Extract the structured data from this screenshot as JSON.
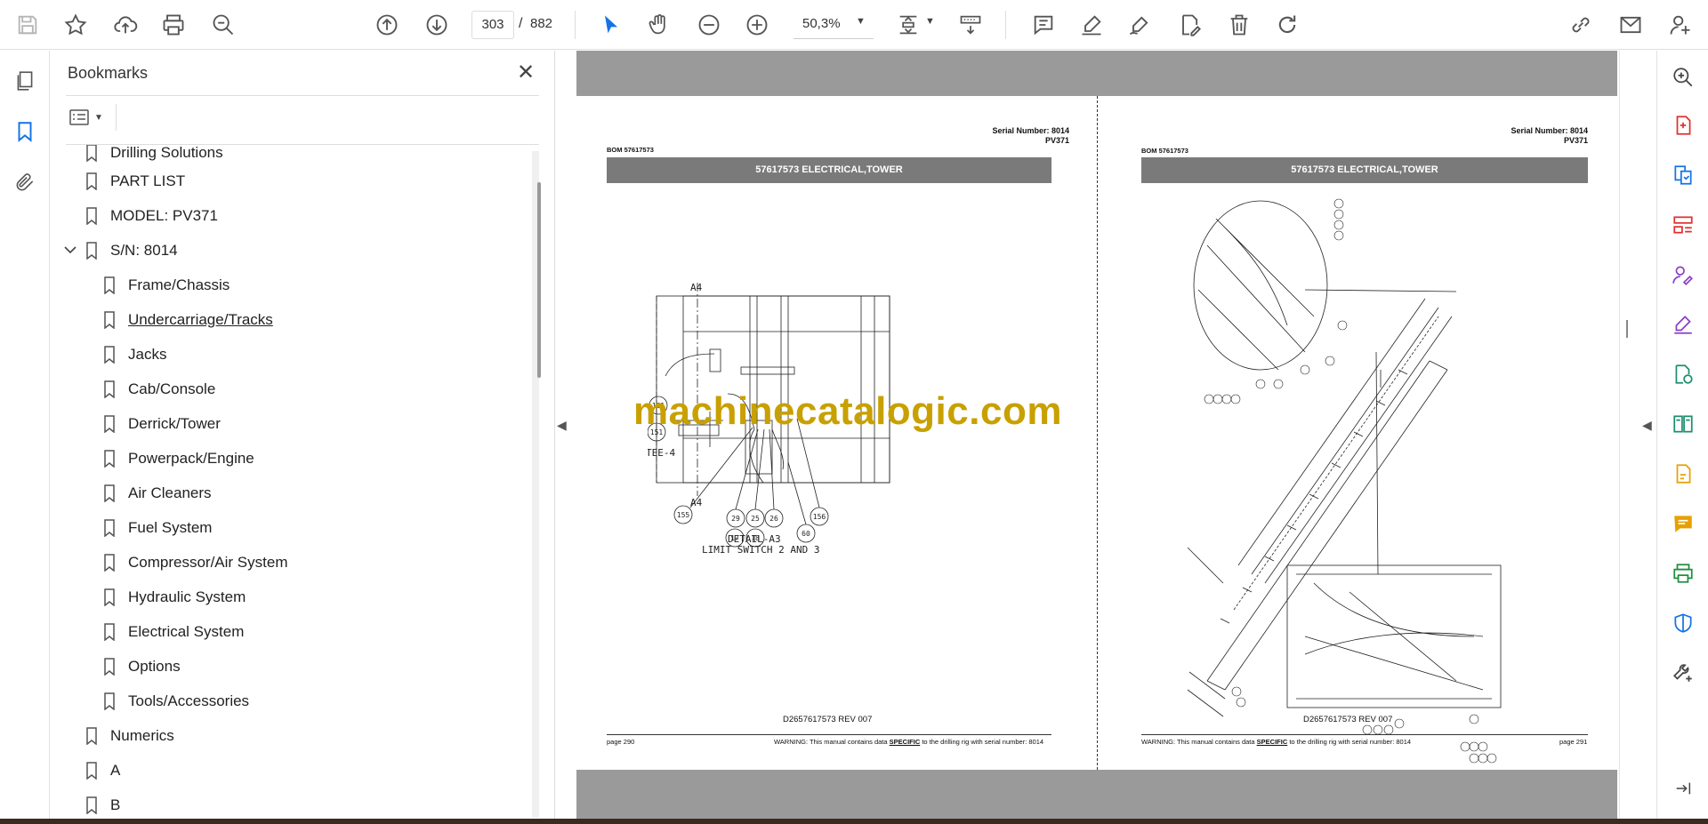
{
  "toolbar": {
    "page_current": "303",
    "page_separator": "/",
    "page_total": "882",
    "zoom": "50,3%"
  },
  "bookmarks": {
    "title": "Bookmarks",
    "items": [
      {
        "label": "Drilling Solutions",
        "level": 1
      },
      {
        "label": "PART LIST",
        "level": 1
      },
      {
        "label": "MODEL: PV371",
        "level": 1
      },
      {
        "label": "S/N: 8014",
        "level": 1,
        "expanded": true
      },
      {
        "label": "Frame/Chassis",
        "level": 2
      },
      {
        "label": "Undercarriage/Tracks",
        "level": 2,
        "hovered": true
      },
      {
        "label": "Jacks",
        "level": 2
      },
      {
        "label": "Cab/Console",
        "level": 2
      },
      {
        "label": "Derrick/Tower",
        "level": 2
      },
      {
        "label": "Powerpack/Engine",
        "level": 2
      },
      {
        "label": "Air Cleaners",
        "level": 2
      },
      {
        "label": "Fuel System",
        "level": 2
      },
      {
        "label": "Compressor/Air System",
        "level": 2
      },
      {
        "label": "Hydraulic System",
        "level": 2
      },
      {
        "label": "Electrical System",
        "level": 2
      },
      {
        "label": "Options",
        "level": 2
      },
      {
        "label": "Tools/Accessories",
        "level": 2
      },
      {
        "label": "Numerics",
        "level": 1
      },
      {
        "label": "A",
        "level": 1
      },
      {
        "label": "B",
        "level": 1
      }
    ]
  },
  "pages": {
    "left": {
      "serial_number": "Serial Number: 8014",
      "model": "PV371",
      "bom": "BOM 57617573",
      "section_title": "57617573 ELECTRICAL,TOWER",
      "detail_title": "DETAIL-A3",
      "detail_subtitle": "LIMIT SWITCH 2 AND 3",
      "section_mark_top": "A4",
      "section_mark_bottom": "A4",
      "callouts": [
        "161",
        "151",
        "155",
        "29",
        "25",
        "26",
        "156",
        "17",
        "18",
        "60"
      ],
      "tee_label": "TEE-4",
      "doc_code": "D2657617573 REV 007",
      "page_label": "page 290",
      "warning_pre": "WARNING:  This manual contains data ",
      "warning_emph": "SPECIFIC",
      "warning_post": " to the drilling rig with serial number: 8014"
    },
    "right": {
      "serial_number": "Serial Number: 8014",
      "model": "PV371",
      "bom": "BOM 57617573",
      "section_title": "57617573 ELECTRICAL,TOWER",
      "doc_code": "D2657617573 REV 007",
      "page_label": "page 291",
      "warning_pre": "WARNING:  This manual contains data ",
      "warning_emph": "SPECIFIC",
      "warning_post": " to the drilling rig with serial number: 8014"
    }
  },
  "watermark": "machinecatalogic.com",
  "colors": {
    "accent_blue": "#1473e6",
    "watermark_gold": "#c8a000",
    "section_bar": "#7a7a7a",
    "gray_canvas": "#9a9a9a"
  }
}
